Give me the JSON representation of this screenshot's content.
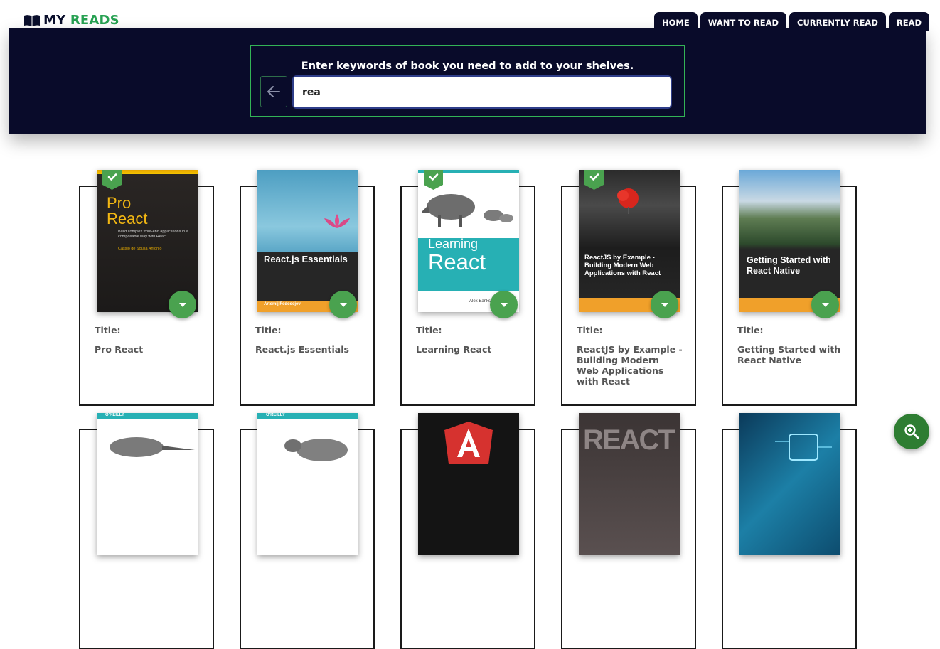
{
  "brand": {
    "my": "MY",
    "reads": "READS",
    "colors": {
      "navy": "#0a0c2a",
      "green": "#27a152"
    }
  },
  "nav": {
    "tabs": [
      "HOME",
      "WANT TO READ",
      "CURRENTLY READ",
      "READ"
    ]
  },
  "search": {
    "title": "Enter keywords of book you need to add to your shelves.",
    "value": "rea",
    "back_icon": "arrow-left-icon"
  },
  "books": [
    {
      "title_label": "Title:",
      "title": "Pro React",
      "on_shelf": true,
      "cover": {
        "line1": "Pro",
        "line2": "React",
        "sub": "Build complex front-end applications in a composable way with React",
        "author": "Cássio de Sousa Antonio"
      }
    },
    {
      "title_label": "Title:",
      "title": "React.js Essentials",
      "on_shelf": false,
      "cover": {
        "heading": "React.js Essentials",
        "author": "Artemij Fedosejev"
      }
    },
    {
      "title_label": "Title:",
      "title": "Learning React",
      "on_shelf": true,
      "cover": {
        "heading1": "Learning",
        "heading2": "React",
        "author": "Alex Banks"
      }
    },
    {
      "title_label": "Title:",
      "title": "ReactJS by Example - Building Modern Web Applications with React",
      "on_shelf": true,
      "cover": {
        "heading": "ReactJS by Example - Building Modern Web Applications with React"
      }
    },
    {
      "title_label": "Title:",
      "title": "Getting Started with React Native",
      "on_shelf": false,
      "cover": {
        "heading": "Getting Started with React Native"
      }
    }
  ],
  "second_row": [
    {
      "publisher": "O'REILLY"
    },
    {
      "publisher": "O'REILLY"
    },
    {
      "publisher": ""
    },
    {
      "heading": "REACT"
    },
    {
      "publisher": ""
    }
  ],
  "fab": {
    "icon": "zoom-in-icon"
  }
}
